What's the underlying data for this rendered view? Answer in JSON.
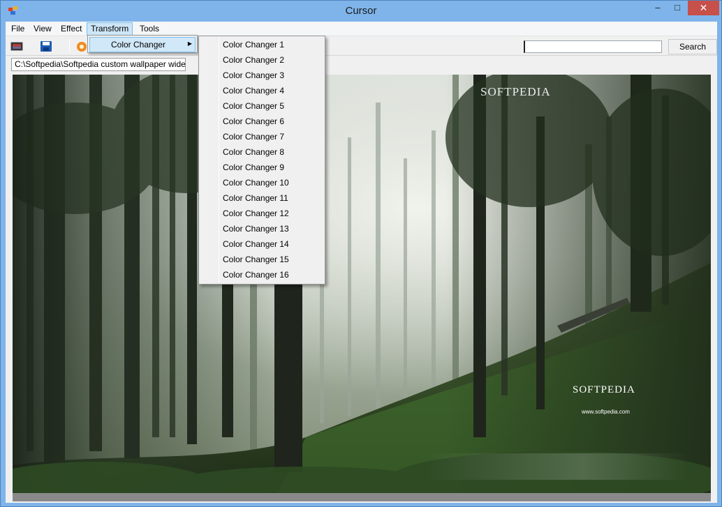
{
  "window": {
    "title": "Cursor",
    "controls": {
      "minimize": "–",
      "maximize": "□",
      "close": "✕"
    }
  },
  "menubar": {
    "items": [
      "File",
      "View",
      "Effect",
      "Transform",
      "Tools"
    ],
    "active": "Transform"
  },
  "toolbar": {
    "icons": [
      "image-icon",
      "save-icon",
      "color-wheel-icon"
    ],
    "search_value": "",
    "search_label": "Search"
  },
  "path": "C:\\Softpedia\\Softpedia custom wallpaper wide.jpg",
  "transform_menu": {
    "item": "Color Changer",
    "arrow": "▶"
  },
  "color_changer_submenu": [
    "Color Changer 1",
    "Color Changer 2",
    "Color Changer 3",
    "Color Changer 4",
    "Color Changer 5",
    "Color Changer 6",
    "Color Changer 7",
    "Color Changer 8",
    "Color Changer 9",
    "Color Changer 10",
    "Color Changer 11",
    "Color Changer 12",
    "Color Changer 13",
    "Color Changer 14",
    "Color Changer 15",
    "Color Changer 16"
  ],
  "image": {
    "watermark_top": "SOFTPEDIA",
    "watermark_bottom": "SOFTPEDIA",
    "watermark_url": "www.softpedia.com"
  },
  "colors": {
    "title_bar": "#7fb4ea",
    "close_button": "#c7504a",
    "menu_highlight": "#cde6f7"
  }
}
